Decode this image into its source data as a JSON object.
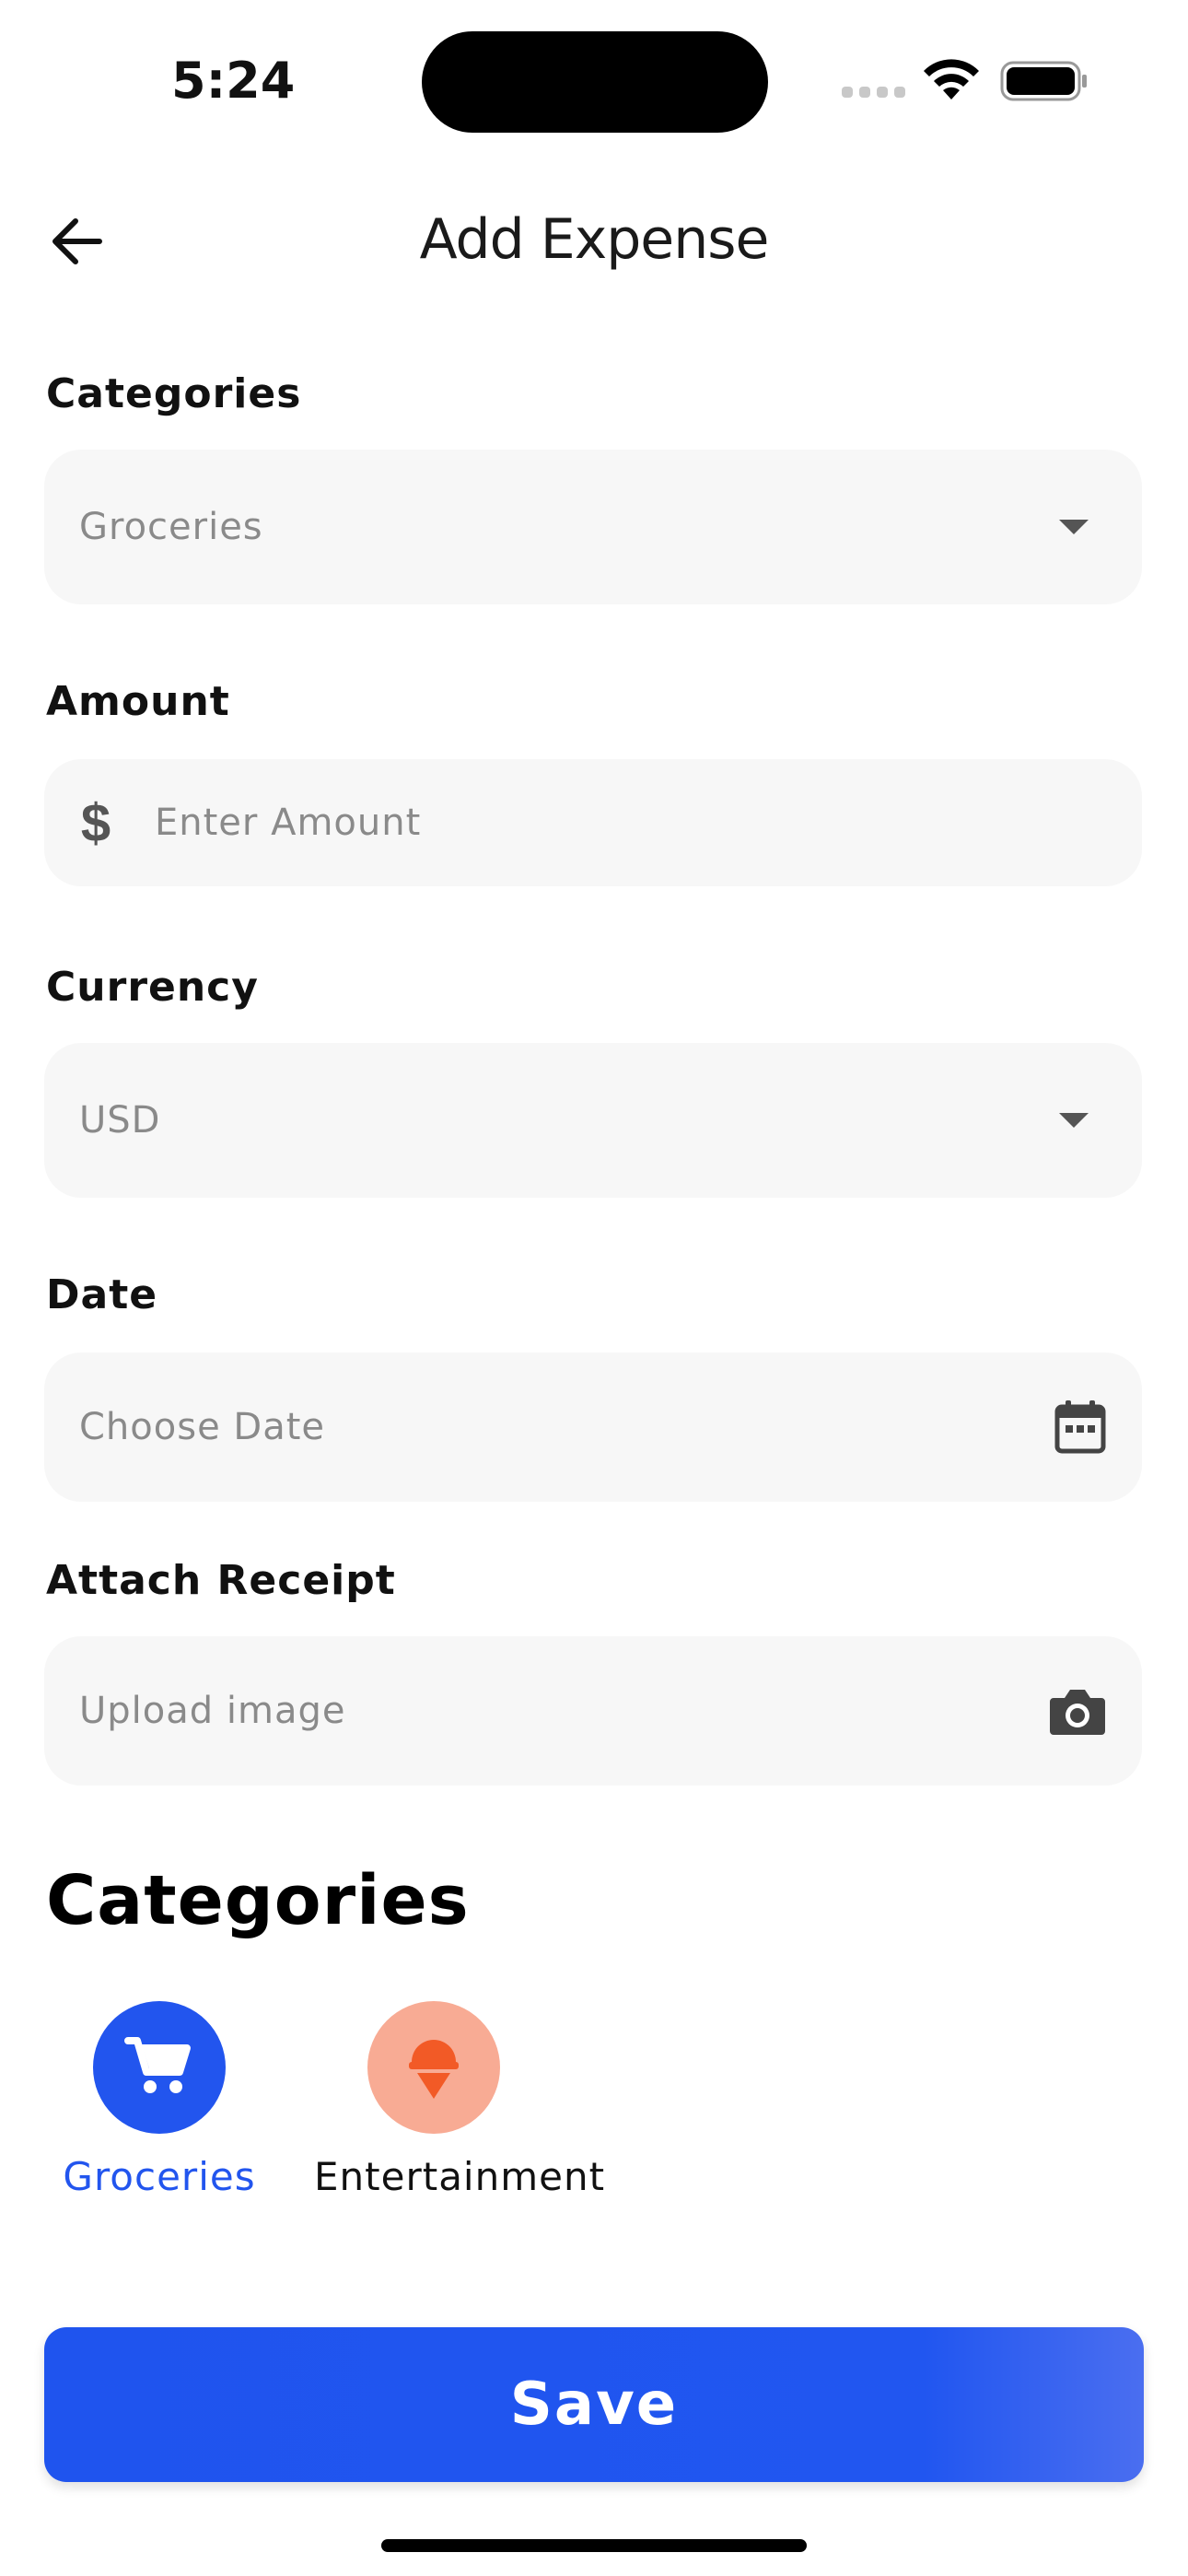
{
  "status_bar": {
    "time": "5:24"
  },
  "header": {
    "title": "Add Expense"
  },
  "form": {
    "category": {
      "label": "Categories",
      "value": "Groceries"
    },
    "amount": {
      "label": "Amount",
      "currency_symbol": "$",
      "placeholder": "Enter Amount"
    },
    "currency": {
      "label": "Currency",
      "value": "USD"
    },
    "date": {
      "label": "Date",
      "placeholder": "Choose Date"
    },
    "receipt": {
      "label": "Attach Receipt",
      "placeholder": "Upload image"
    }
  },
  "categories": {
    "title": "Categories",
    "items": [
      {
        "label": "Groceries",
        "icon": "shopping-cart-icon",
        "selected": true,
        "color": "#2255ee",
        "text_color": "#2255ee"
      },
      {
        "label": "Entertainment",
        "icon": "ice-cream-icon",
        "selected": false,
        "color": "#f8ab94",
        "text_color": "#111111"
      }
    ]
  },
  "actions": {
    "save_label": "Save"
  },
  "colors": {
    "accent": "#2156f0",
    "field_bg": "#f7f7f7",
    "icon_orange": "#f25a26"
  }
}
